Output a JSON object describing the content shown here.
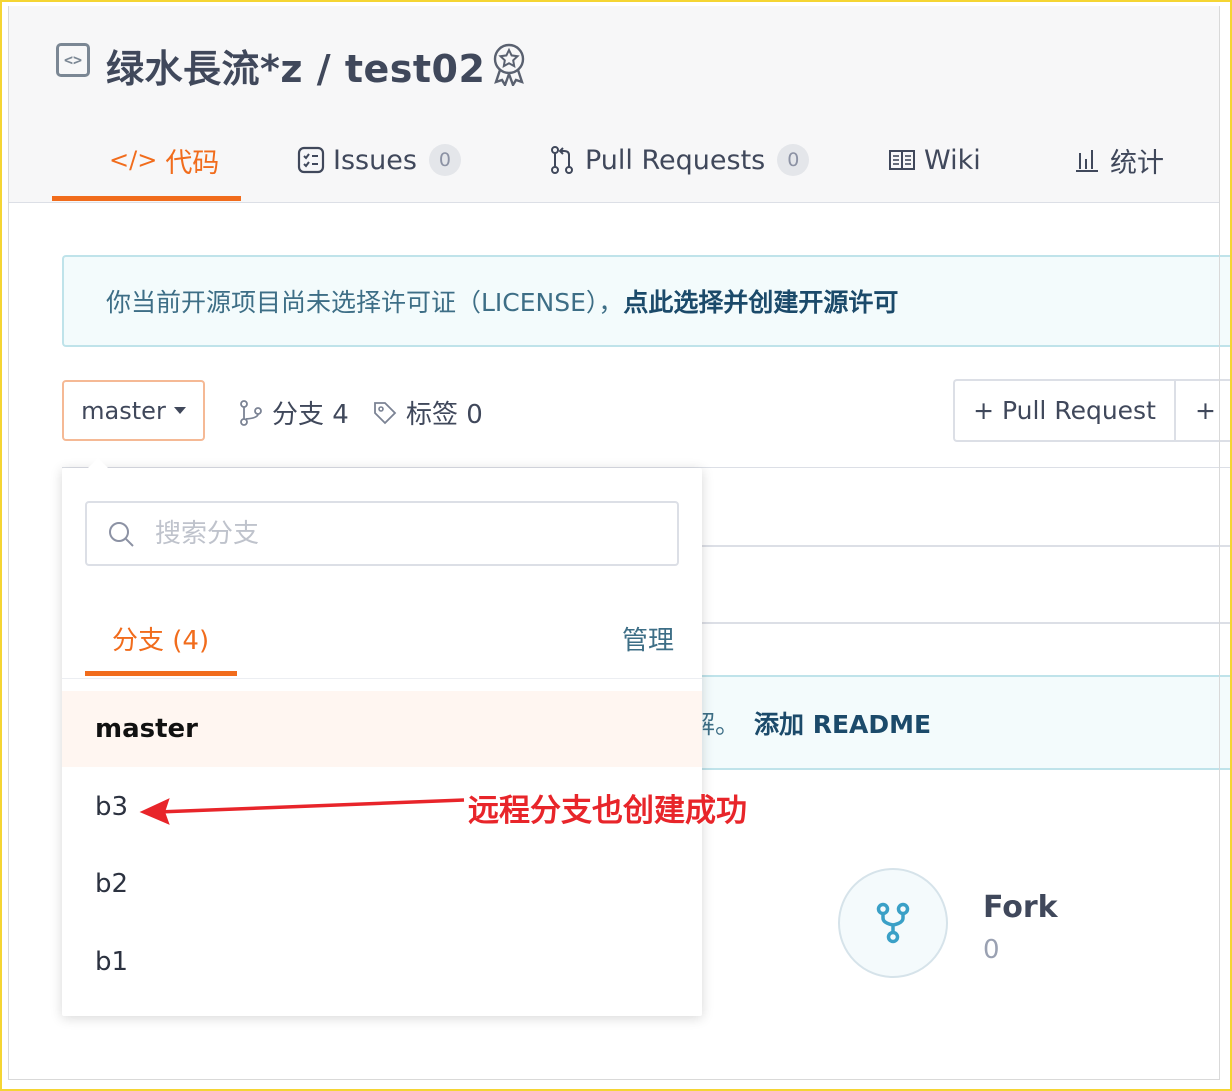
{
  "repo": {
    "title": "绿水長流*z / test02"
  },
  "tabs": [
    {
      "label": "代码",
      "icon": "code-icon",
      "active": true
    },
    {
      "label": "Issues",
      "count": "0",
      "icon": "issues-icon"
    },
    {
      "label": "Pull Requests",
      "count": "0",
      "icon": "pull-request-icon"
    },
    {
      "label": "Wiki",
      "icon": "wiki-icon"
    },
    {
      "label": "统计",
      "icon": "stats-icon"
    }
  ],
  "license_notice": {
    "text": "你当前开源项目尚未选择许可证（LICENSE），",
    "link": "点此选择并创建开源许可"
  },
  "toolbar": {
    "branch": "master",
    "branches_label": "分支 4",
    "tags_label": "标签 0",
    "pull_request_button": "+ Pull Request",
    "second_button": "+"
  },
  "dropdown": {
    "search_placeholder": "搜索分支",
    "tab_label": "分支 (4)",
    "manage_label": "管理",
    "items": [
      "master",
      "b3",
      "b2",
      "b1"
    ]
  },
  "readme_bar": {
    "text": "解。",
    "link": "添加 README"
  },
  "fork": {
    "label": "Fork",
    "count": "0"
  },
  "annotation": {
    "text": "远程分支也创建成功",
    "color": "#e8252a"
  },
  "colors": {
    "accent": "#f16c1c",
    "link": "#1b4a6a"
  }
}
